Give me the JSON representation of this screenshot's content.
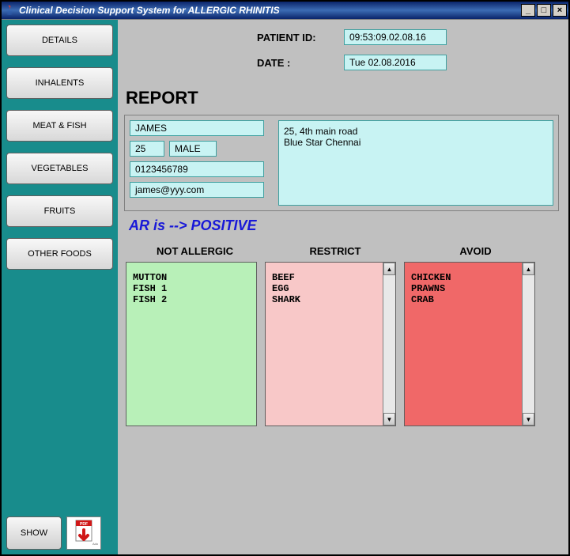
{
  "window": {
    "title": "Clinical Decision Support System for ALLERGIC RHINITIS"
  },
  "sidebar": {
    "buttons": [
      "DETAILS",
      "INHALENTS",
      "MEAT & FISH",
      "VEGETABLES",
      "FRUITS",
      "OTHER FOODS"
    ]
  },
  "header": {
    "patient_id_label": "PATIENT ID:",
    "patient_id": "09:53:09.02.08.16",
    "date_label": "DATE :",
    "date": "Tue 02.08.2016"
  },
  "report": {
    "title": "REPORT",
    "name": "JAMES",
    "age": "25",
    "gender": "MALE",
    "phone": "0123456789",
    "email": "james@yyy.com",
    "address": "25, 4th main road\nBlue Star Chennai",
    "status": "AR is --> POSITIVE"
  },
  "categories": {
    "not_allergic": {
      "label": "NOT ALLERGIC",
      "items": "MUTTON\nFISH 1\nFISH 2"
    },
    "restrict": {
      "label": "RESTRICT",
      "items": "BEEF\nEGG\nSHARK"
    },
    "avoid": {
      "label": "AVOID",
      "items": "CHICKEN\nPRAWNS\nCRAB"
    }
  },
  "bottom": {
    "show_label": "SHOW"
  }
}
